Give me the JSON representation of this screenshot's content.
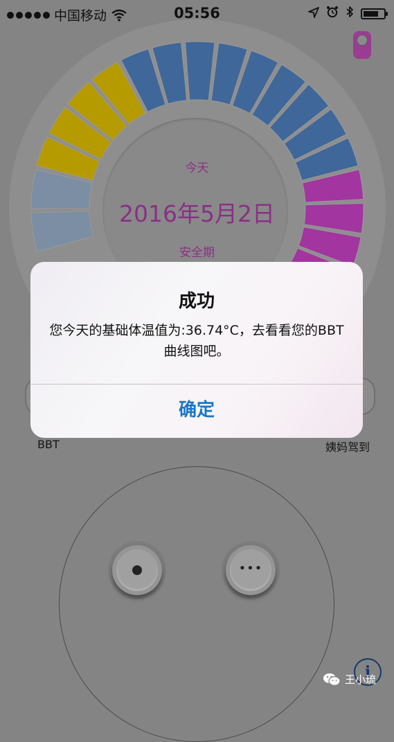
{
  "status_bar": {
    "carrier": "中国移动",
    "time": "05:56",
    "battery_level": 0.75
  },
  "icons": {
    "signal": "signal-dots",
    "wifi": "wifi-icon",
    "location": "location-arrow-icon",
    "alarm": "alarm-clock-icon",
    "bluetooth": "bluetooth-icon",
    "battery": "battery-icon",
    "info": "info-icon",
    "wechat": "wechat-icon"
  },
  "wheel": {
    "today_label": "今天",
    "date": "2016年5月2日",
    "period_label": "安全期",
    "colors": {
      "safe_light": "#7c8ea3",
      "fertile": "#b59a00",
      "safe_blue": "#3f6799",
      "period": "#a235a0"
    }
  },
  "labels": {
    "bbt": "BBT",
    "period_arrival": "姨妈驾到"
  },
  "controls": {
    "more_label": "•••"
  },
  "info_button": {
    "label": "i"
  },
  "watermark": {
    "text": "王小琉"
  },
  "alert": {
    "title": "成功",
    "message": "您今天的基础体温值为:36.74°C，去看看您的BBT曲线图吧。",
    "ok_label": "确定",
    "accent": "#1a77c6"
  }
}
